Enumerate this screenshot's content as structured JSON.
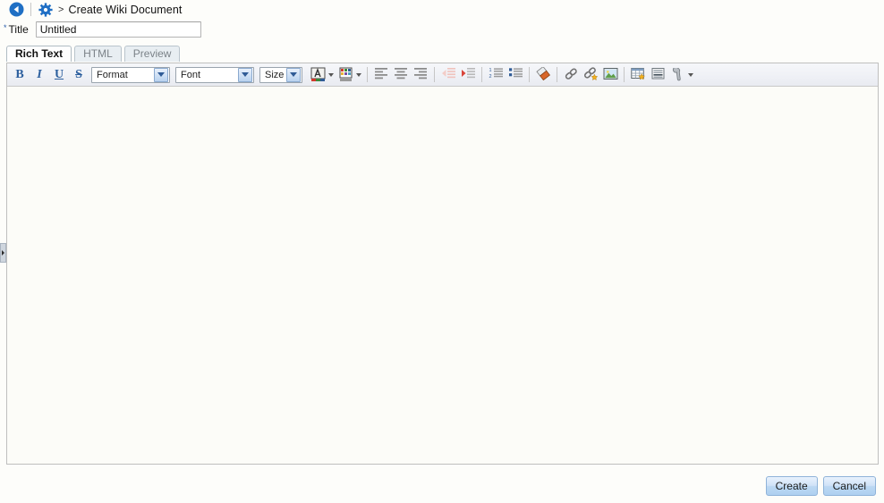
{
  "header": {
    "back_icon": "back-arrow-icon",
    "gear_icon": "gear-icon",
    "separator": ">",
    "title": "Create Wiki Document"
  },
  "title_field": {
    "required_marker": "*",
    "label": "Title",
    "value": "Untitled",
    "placeholder": ""
  },
  "tabs": [
    {
      "label": "Rich Text",
      "active": true
    },
    {
      "label": "HTML",
      "active": false
    },
    {
      "label": "Preview",
      "active": false
    }
  ],
  "toolbar": {
    "bold": "B",
    "italic": "I",
    "underline": "U",
    "strikethrough": "S",
    "format_select": "Format",
    "font_select": "Font",
    "size_select": "Size",
    "text_color": "text-color-icon",
    "background_color": "background-color-icon",
    "align_left": "align-left-icon",
    "align_center": "align-center-icon",
    "align_right": "align-right-icon",
    "outdent": "outdent-icon",
    "indent": "indent-icon",
    "numbered_list": "numbered-list-icon",
    "bulleted_list": "bulleted-list-icon",
    "remove_format": "eraser-icon",
    "link": "link-icon",
    "insert_link": "insert-link-icon",
    "image": "image-icon",
    "insert_table": "insert-table-icon",
    "horizontal_rule": "horizontal-rule-icon",
    "tools": "wrench-icon"
  },
  "editor": {
    "content": "",
    "resize_grip": "resize-grip-icon"
  },
  "footer": {
    "create_label": "Create",
    "cancel_label": "Cancel"
  },
  "splitter": {
    "collapse_icon": "collapse-arrow-icon"
  },
  "colors": {
    "accent_blue": "#1f6fc4",
    "required_marker": "#2a5caa",
    "button_blue": "#aed0f0",
    "tab_inactive": "#e8eef2",
    "editor_bg": "#fcfcf8"
  }
}
